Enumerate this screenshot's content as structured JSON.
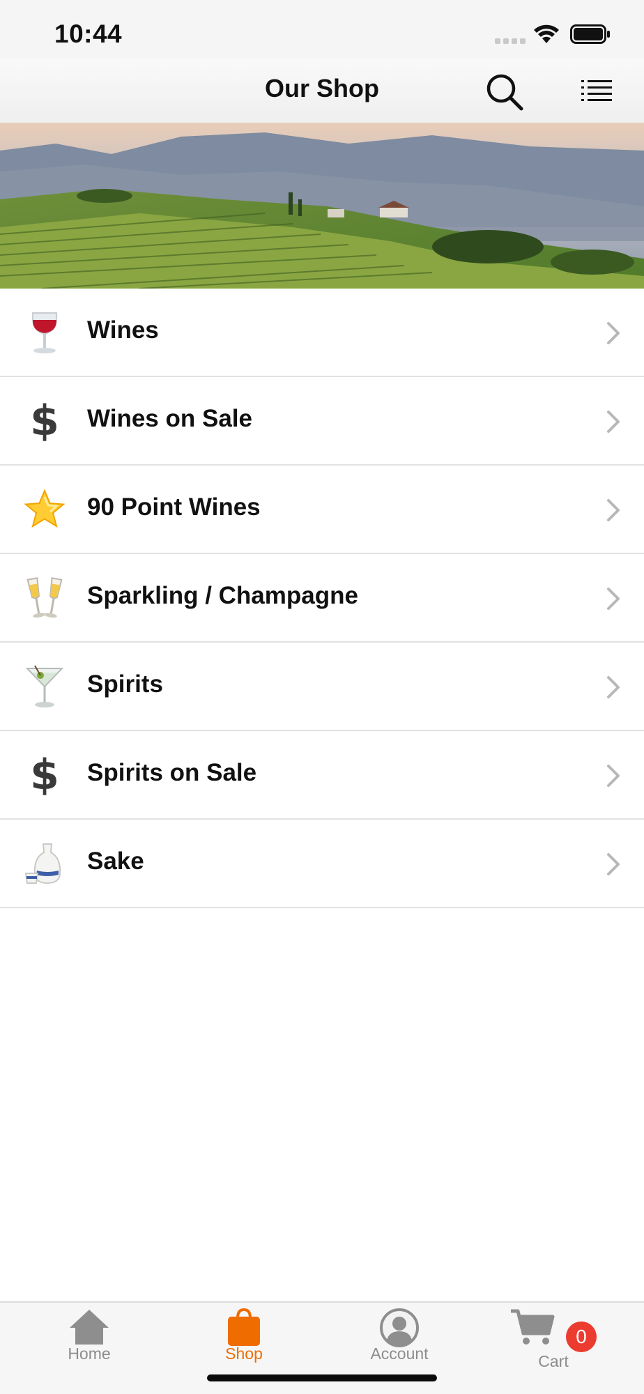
{
  "status_bar": {
    "time": "10:44"
  },
  "nav": {
    "title": "Our Shop",
    "search_icon": "search-icon",
    "menu_icon": "list-menu-icon"
  },
  "banner": {
    "description_icon": "vineyard-landscape-image"
  },
  "categories": [
    {
      "label": "Wines",
      "icon": "wine-glass-icon"
    },
    {
      "label": "Wines on Sale",
      "icon": "dollar-sign-icon"
    },
    {
      "label": "90 Point Wines",
      "icon": "star-icon"
    },
    {
      "label": "Sparkling / Champagne",
      "icon": "champagne-glasses-icon"
    },
    {
      "label": "Spirits",
      "icon": "cocktail-glass-icon"
    },
    {
      "label": "Spirits on Sale",
      "icon": "dollar-sign-icon"
    },
    {
      "label": "Sake",
      "icon": "sake-bottle-icon"
    }
  ],
  "tabs": [
    {
      "label": "Home",
      "icon": "home-icon",
      "active": false
    },
    {
      "label": "Shop",
      "icon": "shopping-bag-icon",
      "active": true
    },
    {
      "label": "Account",
      "icon": "account-icon",
      "active": false
    },
    {
      "label": "Cart",
      "icon": "cart-icon",
      "active": false
    }
  ],
  "cart": {
    "count": "0"
  },
  "colors": {
    "accent": "#ef6c00",
    "badge": "#ec3b2f",
    "inactive_tab": "#8c8c8c",
    "divider": "#e2e2e2"
  }
}
